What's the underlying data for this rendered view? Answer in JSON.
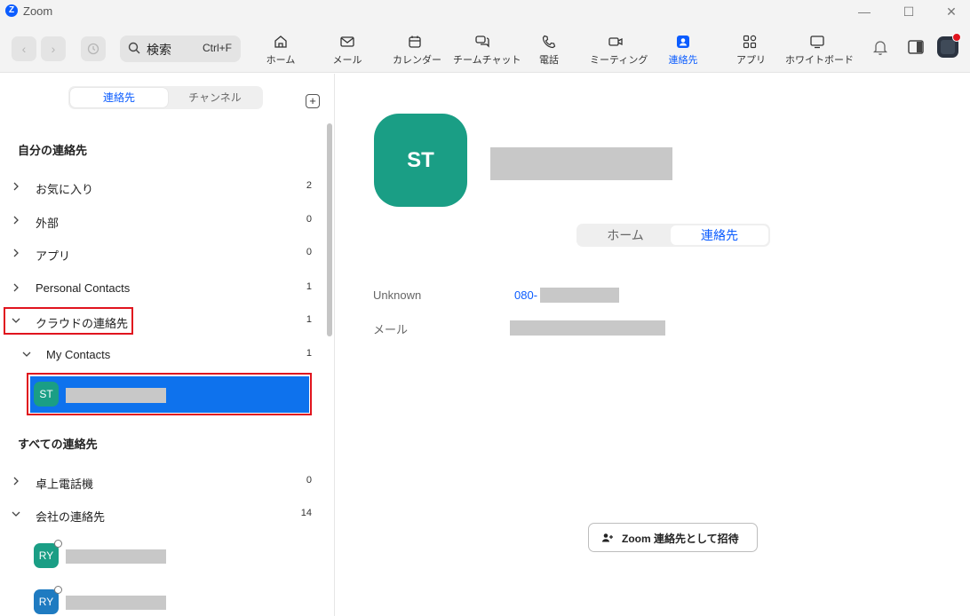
{
  "window": {
    "app_logo": "Z",
    "title": "Zoom"
  },
  "toolbar": {
    "search_label": "検索",
    "search_shortcut": "Ctrl+F",
    "tools": [
      {
        "label": "ホーム",
        "icon": "home-icon"
      },
      {
        "label": "メール",
        "icon": "mail-icon"
      },
      {
        "label": "カレンダー",
        "icon": "calendar-icon"
      },
      {
        "label": "チームチャット",
        "icon": "chat-icon"
      },
      {
        "label": "電話",
        "icon": "phone-icon"
      },
      {
        "label": "ミーティング",
        "icon": "video-icon"
      },
      {
        "label": "連絡先",
        "icon": "contacts-icon",
        "active": true
      },
      {
        "label": "アプリ",
        "icon": "apps-icon"
      },
      {
        "label": "ホワイトボード",
        "icon": "whiteboard-icon"
      }
    ]
  },
  "sidebar": {
    "tabs": [
      "連絡先",
      "チャンネル"
    ],
    "my_contacts_title": "自分の連絡先",
    "groups": [
      {
        "label": "お気に入り",
        "count": "2"
      },
      {
        "label": "外部",
        "count": "0"
      },
      {
        "label": "アプリ",
        "count": "0"
      },
      {
        "label": "Personal Contacts",
        "count": "1"
      },
      {
        "label": "クラウドの連絡先",
        "count": "1"
      },
      {
        "label": "My Contacts",
        "count": "1"
      }
    ],
    "selected_contact": {
      "initials": "ST"
    },
    "all_contacts_title": "すべての連絡先",
    "all_groups": [
      {
        "label": "卓上電話機",
        "count": "0"
      },
      {
        "label": "会社の連絡先",
        "count": "14"
      }
    ],
    "company_contacts": [
      {
        "initials": "RY",
        "color": "#1a9e85"
      },
      {
        "initials": "RY",
        "color": "#1f7bc1"
      }
    ]
  },
  "detail": {
    "initials": "ST",
    "avatar_color": "#1a9e85",
    "tabs": [
      "ホーム",
      "連絡先"
    ],
    "phone_label": "Unknown",
    "phone_value": "080-",
    "email_label": "メール",
    "invite_button": "Zoom 連絡先として招待"
  },
  "colors": {
    "accent": "#0b5cff",
    "selection": "#0e72ed",
    "highlight": "#e0141e"
  }
}
